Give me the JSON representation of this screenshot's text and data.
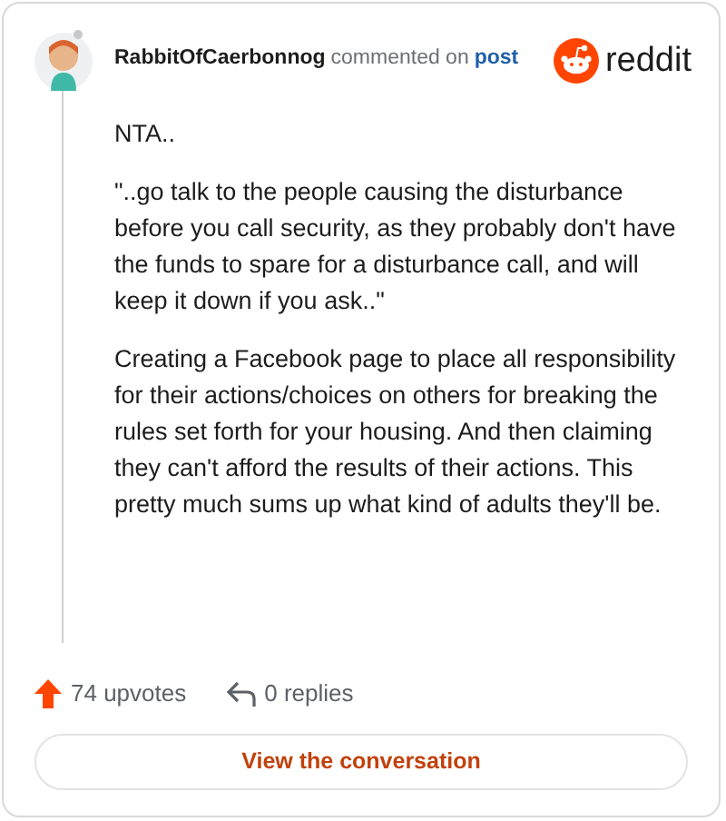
{
  "header": {
    "username": "RabbitOfCaerbonnog",
    "action": "commented on",
    "link": "post",
    "brand": "reddit"
  },
  "comment": {
    "paragraphs": [
      "NTA..",
      "\"..go talk to the people causing the disturbance before you call security, as they probably don't have the funds to spare for a disturbance call, and will keep it down if you ask..\"",
      "Creating a Facebook page to place all responsibility for their actions/choices on others for breaking the rules set forth for your housing. And then claiming they can't afford the results of their actions. This pretty much sums up what kind of adults they'll be."
    ]
  },
  "footer": {
    "upvotes": "74 upvotes",
    "replies": "0 replies",
    "button": "View the conversation"
  }
}
